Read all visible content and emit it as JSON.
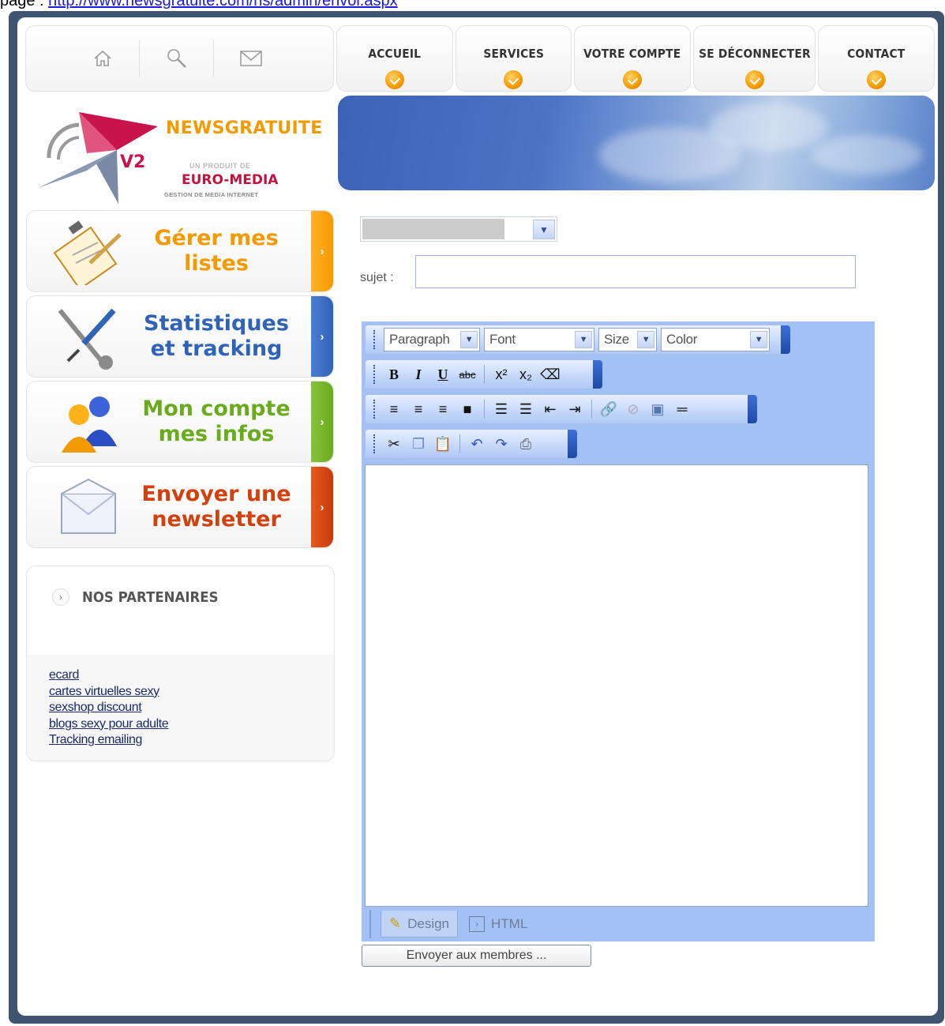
{
  "caption": {
    "prefix": "page : ",
    "link": "http://www.newsgratuite.com/ns/admin/envoi.aspx"
  },
  "top_icons": [
    "home-icon",
    "search-icon",
    "mail-icon"
  ],
  "nav": {
    "tabs": [
      "ACCUEIL",
      "SERVICES",
      "VOTRE COMPTE",
      "SE DÉCONNECTER",
      "CONTACT"
    ],
    "accent": "#f39a00"
  },
  "logo": {
    "name": "NEWSGRATUITE",
    "badge": "V2",
    "product_of": "UN PRODUIT DE",
    "company": "EURO-MEDIA",
    "tagline": "GESTION DE MEDIA INTERNET"
  },
  "menu": [
    {
      "label": "Gérer mes listes",
      "color": "#f39a00"
    },
    {
      "label": "Statistiques et tracking",
      "color": "#2f63b6"
    },
    {
      "label": "Mon compte mes infos",
      "color": "#6aab1e"
    },
    {
      "label": "Envoyer une newsletter",
      "color": "#d2400e"
    }
  ],
  "partners": {
    "title": "NOS PARTENAIRES",
    "links": [
      "ecard",
      "cartes virtuelles sexy",
      "sexshop discount",
      "blogs sexy pour adulte",
      "Tracking emailing"
    ]
  },
  "form": {
    "subject_label": "sujet   :",
    "subject_value": "",
    "list_select_value": ""
  },
  "editor": {
    "paragraph": "Paragraph",
    "font": "Font",
    "size": "Size",
    "color": "Color",
    "tabs": {
      "design": "Design",
      "html": "HTML"
    }
  },
  "send_button": "Envoyer aux membres ..."
}
